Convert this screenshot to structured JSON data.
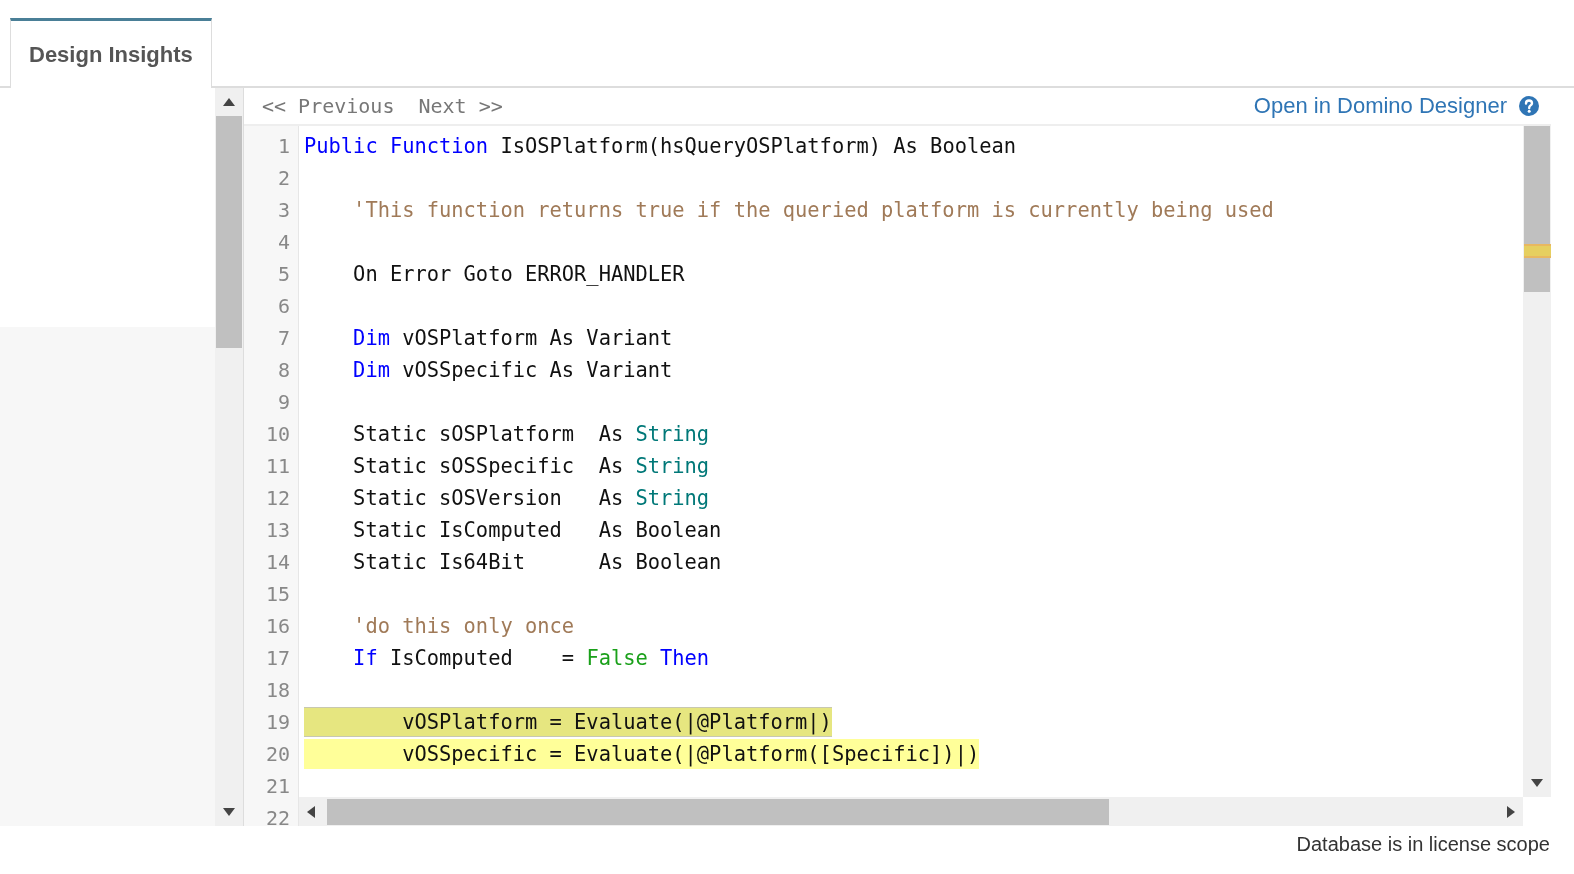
{
  "tabs": [
    {
      "label": "Design Insights",
      "selected": true
    }
  ],
  "toolbar": {
    "previous": "<< Previous",
    "next": "Next >>",
    "open_link": "Open in Domino Designer"
  },
  "code": {
    "lines": [
      {
        "number": "1",
        "highlighted": false,
        "selected": false,
        "tokens": [
          {
            "kind": "keyword",
            "text": "Public Function"
          },
          {
            "kind": "plain",
            "text": " IsOSPlatform(hsQueryOSPlatform) As Boolean"
          }
        ]
      },
      {
        "number": "2"
      },
      {
        "number": "3",
        "highlighted": false,
        "selected": false,
        "tokens": [
          {
            "kind": "comment",
            "text": "    'This function returns true if the queried platform is currently being used"
          }
        ]
      },
      {
        "number": "4"
      },
      {
        "number": "5",
        "highlighted": false,
        "selected": false,
        "tokens": [
          {
            "kind": "plain",
            "text": "    On Error Goto ERROR_HANDLER"
          }
        ]
      },
      {
        "number": "6"
      },
      {
        "number": "7",
        "highlighted": false,
        "selected": false,
        "tokens": [
          {
            "kind": "keyword",
            "text": "    Dim"
          },
          {
            "kind": "plain",
            "text": " vOSPlatform As Variant"
          }
        ]
      },
      {
        "number": "8",
        "highlighted": false,
        "selected": false,
        "tokens": [
          {
            "kind": "keyword",
            "text": "    Dim"
          },
          {
            "kind": "plain",
            "text": " vOSSpecific As Variant"
          }
        ]
      },
      {
        "number": "9"
      },
      {
        "number": "10",
        "highlighted": false,
        "selected": false,
        "tokens": [
          {
            "kind": "plain",
            "text": "    Static sOSPlatform  As "
          },
          {
            "kind": "type",
            "text": "String"
          }
        ]
      },
      {
        "number": "11",
        "highlighted": false,
        "selected": false,
        "tokens": [
          {
            "kind": "plain",
            "text": "    Static sOSSpecific  As "
          },
          {
            "kind": "type",
            "text": "String"
          }
        ]
      },
      {
        "number": "12",
        "highlighted": false,
        "selected": false,
        "tokens": [
          {
            "kind": "plain",
            "text": "    Static sOSVersion   As "
          },
          {
            "kind": "type",
            "text": "String"
          }
        ]
      },
      {
        "number": "13",
        "highlighted": false,
        "selected": false,
        "tokens": [
          {
            "kind": "plain",
            "text": "    Static IsComputed   As Boolean"
          }
        ]
      },
      {
        "number": "14",
        "highlighted": false,
        "selected": false,
        "tokens": [
          {
            "kind": "plain",
            "text": "    Static Is64Bit      As Boolean"
          }
        ]
      },
      {
        "number": "15"
      },
      {
        "number": "16",
        "highlighted": false,
        "selected": false,
        "tokens": [
          {
            "kind": "comment",
            "text": "    'do this only once"
          }
        ]
      },
      {
        "number": "17",
        "highlighted": false,
        "selected": false,
        "tokens": [
          {
            "kind": "keyword",
            "text": "    If"
          },
          {
            "kind": "plain",
            "text": " IsComputed    = "
          },
          {
            "kind": "literal",
            "text": "False"
          },
          {
            "kind": "keyword",
            "text": " Then"
          }
        ]
      },
      {
        "number": "18"
      },
      {
        "number": "19",
        "highlighted": true,
        "selected": true,
        "tokens": [
          {
            "kind": "plain",
            "text": "        vOSPlatform = Evaluate(|@Platform|)"
          }
        ]
      },
      {
        "number": "20",
        "highlighted": true,
        "selected": false,
        "tokens": [
          {
            "kind": "plain",
            "text": "        vOSSpecific = Evaluate(|@Platform([Specific])|)"
          }
        ]
      },
      {
        "number": "21"
      },
      {
        "number": "22"
      }
    ]
  },
  "status_bar": "Database is in license scope"
}
